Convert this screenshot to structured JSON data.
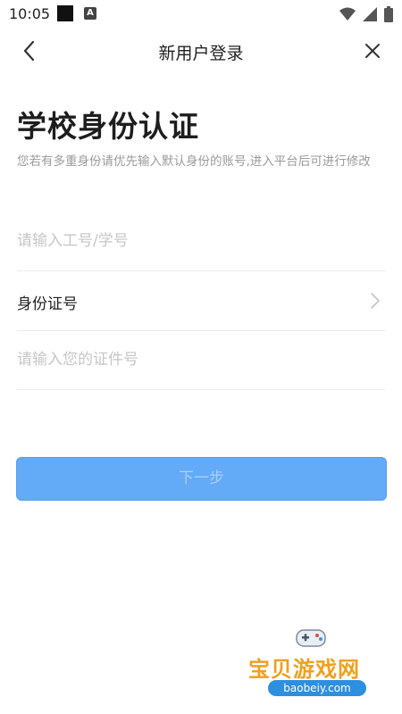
{
  "status_bar": {
    "time": "10:05",
    "notification_letter": "A"
  },
  "nav": {
    "title": "新用户登录"
  },
  "form": {
    "heading": "学校身份认证",
    "subtitle": "您若有多重身份请优先输入默认身份的账号,进入平台后可进行修改",
    "id_placeholder": "请输入工号/学号",
    "id_type_label": "身份证号",
    "cert_placeholder": "请输入您的证件号",
    "next_label": "下一步"
  },
  "watermark": {
    "text": "宝贝游戏网",
    "url": "baobeiy.com"
  },
  "colors": {
    "primary_button": "#63aaf7",
    "primary_button_text": "#a9d0fb",
    "placeholder": "#c6c6c6",
    "subtitle": "#9a9a9a"
  }
}
